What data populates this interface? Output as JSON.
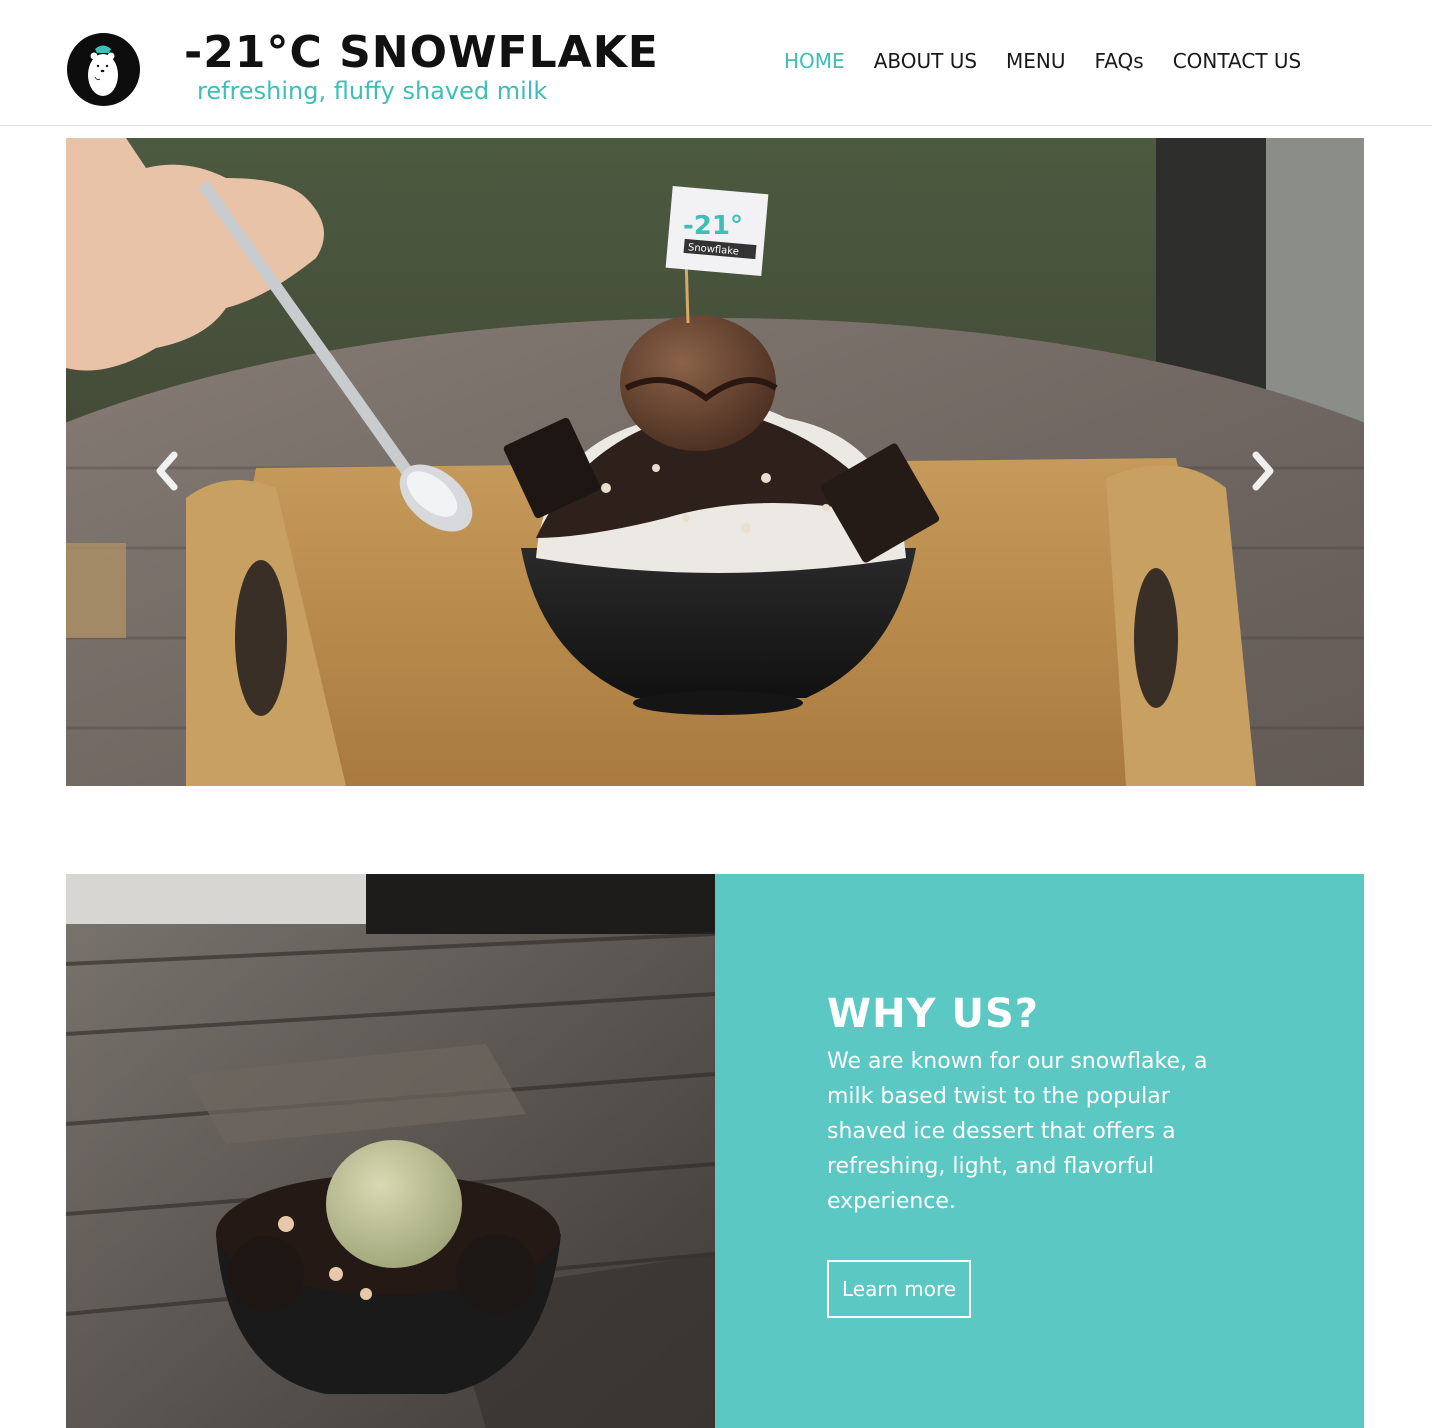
{
  "brand": {
    "title": "-21°C SNOWFLAKE",
    "tagline": "refreshing, fluffy shaved milk",
    "logo_icon": "polar-bear-logo"
  },
  "nav": {
    "items": [
      {
        "label": "HOME",
        "active": true
      },
      {
        "label": "ABOUT US",
        "active": false
      },
      {
        "label": "MENU",
        "active": false
      },
      {
        "label": "FAQs",
        "active": false
      },
      {
        "label": "CONTACT US",
        "active": false
      }
    ]
  },
  "hero": {
    "image": "chocolate-snowflake-dessert-photo",
    "flag_text_top": "-21°",
    "flag_text_bottom": "Snowflake",
    "prev_icon": "chevron-left-icon",
    "next_icon": "chevron-right-icon"
  },
  "feature": {
    "image": "matcha-snowflake-dessert-photo",
    "title": "WHY US?",
    "text": "We are known for our snowflake, a milk based twist to the popular shaved ice dessert that offers a refreshing, light, and flavorful experience.",
    "button_label": "Learn more"
  },
  "colors": {
    "accent": "#3cbfb6",
    "panel": "#5bc8c4",
    "text": "#1a1a1a"
  }
}
